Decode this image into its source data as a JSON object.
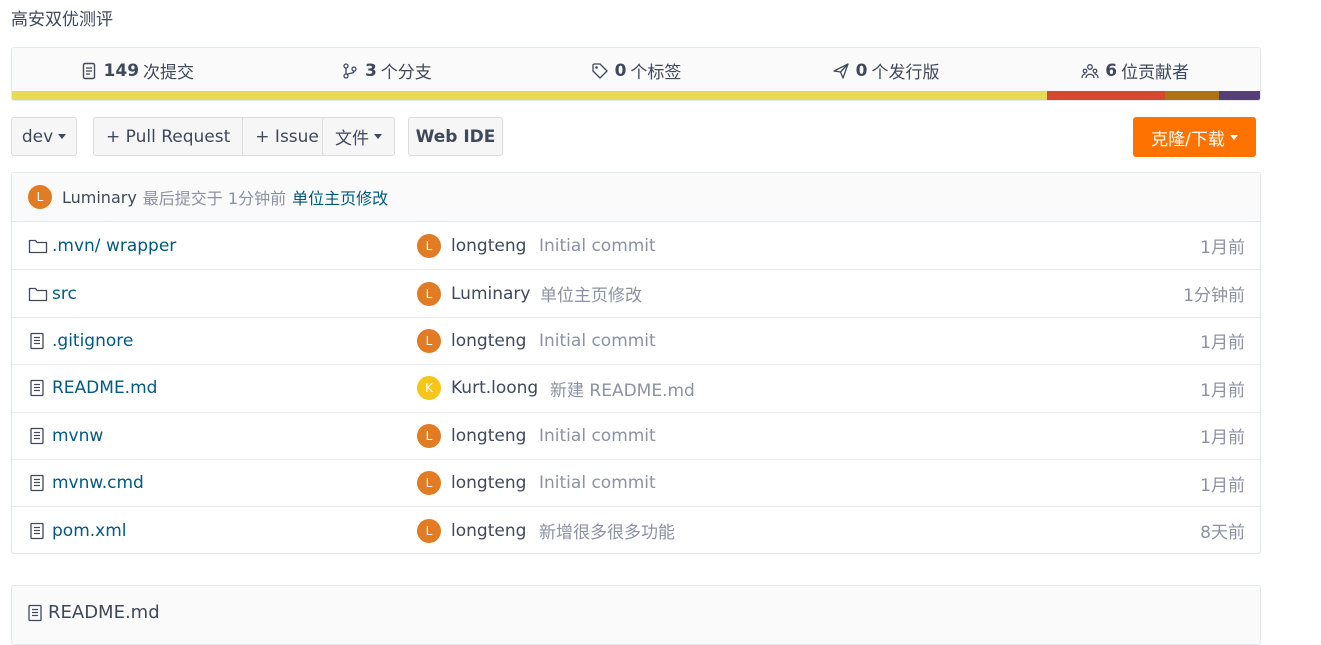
{
  "repo": {
    "description": "高安双优测评"
  },
  "stats": {
    "commits_num": "149",
    "commits_label": "次提交",
    "branches_num": "3",
    "branches_label": "个分支",
    "tags_num": "0",
    "tags_label": "个标签",
    "releases_num": "0",
    "releases_label": "个发行版",
    "contributors_num": "6",
    "contributors_label": "位贡献者"
  },
  "lang_bar": [
    {
      "color": "#e8d958",
      "share": 0.829
    },
    {
      "color": "#d6492f",
      "share": 0.095
    },
    {
      "color": "#b07219",
      "share": 0.043
    },
    {
      "color": "#563d7c",
      "share": 0.033
    }
  ],
  "toolbar": {
    "branch": "dev",
    "pull_request": "+ Pull Request",
    "issue": "+ Issue",
    "file_menu": "文件",
    "web_ide": "Web IDE",
    "clone": "克隆/下载"
  },
  "last_commit": {
    "avatar_letter": "L",
    "author": "Luminary",
    "meta": "最后提交于 1分钟前",
    "message": "单位主页修改"
  },
  "files": [
    {
      "type": "folder",
      "name_prefix": ".mvn/",
      "name": "wrapper",
      "avatar": "L",
      "avatar_color": "#e17b24",
      "author": "longteng",
      "message": "Initial commit",
      "time": "1月前"
    },
    {
      "type": "folder",
      "name_prefix": "",
      "name": "src",
      "avatar": "L",
      "avatar_color": "#e17b24",
      "author": "Luminary",
      "message": "单位主页修改",
      "time": "1分钟前"
    },
    {
      "type": "file",
      "name_prefix": "",
      "name": ".gitignore",
      "avatar": "L",
      "avatar_color": "#e17b24",
      "author": "longteng",
      "message": "Initial commit",
      "time": "1月前"
    },
    {
      "type": "file",
      "name_prefix": "",
      "name": "README.md",
      "avatar": "K",
      "avatar_color": "#f5c518",
      "author": "Kurt.loong",
      "message": "新建 README.md",
      "time": "1月前"
    },
    {
      "type": "file",
      "name_prefix": "",
      "name": "mvnw",
      "avatar": "L",
      "avatar_color": "#e17b24",
      "author": "longteng",
      "message": "Initial commit",
      "time": "1月前"
    },
    {
      "type": "file",
      "name_prefix": "",
      "name": "mvnw.cmd",
      "avatar": "L",
      "avatar_color": "#e17b24",
      "author": "longteng",
      "message": "Initial commit",
      "time": "1月前"
    },
    {
      "type": "file",
      "name_prefix": "",
      "name": "pom.xml",
      "avatar": "L",
      "avatar_color": "#e17b24",
      "author": "longteng",
      "message": "新增很多很多功能",
      "time": "8天前"
    }
  ],
  "readme": {
    "title": "README.md"
  },
  "colors": {
    "accent": "#fe7300",
    "link": "#005980",
    "avatar_default": "#e17b24"
  }
}
